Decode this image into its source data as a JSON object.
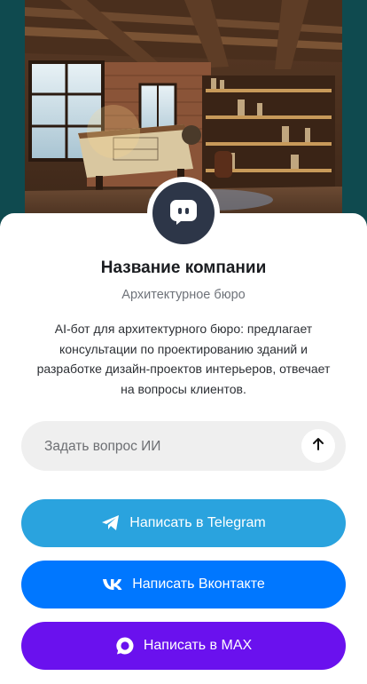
{
  "company": {
    "name": "Название компании",
    "category": "Архитектурное бюро",
    "description": "AI-бот для архитектурного бюро: предлагает консультации по проектированию зданий и разработке дизайн-проектов интерьеров, отвечает на вопросы клиентов."
  },
  "ask": {
    "placeholder": "Задать вопрос ИИ"
  },
  "buttons": {
    "telegram": "Написать в Telegram",
    "vk": "Написать Вконтакте",
    "max": "Написать в MAX"
  },
  "colors": {
    "telegram": "#2aa3de",
    "vk": "#0077ff",
    "max": "#6a11ee",
    "avatar": "#2d3648"
  },
  "icons": {
    "avatar": "chat-bot-icon",
    "send": "arrow-up-icon",
    "telegram": "telegram-icon",
    "vk": "vk-icon",
    "max": "max-icon"
  }
}
